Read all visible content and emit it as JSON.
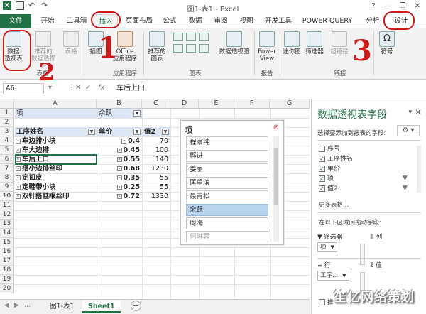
{
  "window": {
    "title": "图1-表1 - Excel",
    "app_logo": "X"
  },
  "tabs": [
    {
      "label": "文件"
    },
    {
      "label": "开始"
    },
    {
      "label": "工具箱"
    },
    {
      "label": "插入"
    },
    {
      "label": "页面布局"
    },
    {
      "label": "公式"
    },
    {
      "label": "数据"
    },
    {
      "label": "审阅"
    },
    {
      "label": "视图"
    },
    {
      "label": "开发工具"
    },
    {
      "label": "POWER QUERY"
    },
    {
      "label": "分析"
    },
    {
      "label": "设计"
    }
  ],
  "ribbon": {
    "pivot_btn": "数据\n透视表",
    "recommend_pivot_btn": "推荐的\n数据透视表",
    "table_btn": "表格",
    "illustrations_btn": "插图",
    "office_apps_btn": "Office\n应用程序",
    "recommended_charts_btn": "推荐的\n图表",
    "pivot_chart_btn": "数据透视图",
    "power_view_btn": "Power\nView",
    "sparkline_btn": "迷你图",
    "slicer_btn": "筛选器",
    "hyperlink_btn": "超链接",
    "symbol_btn": "符号",
    "groups": {
      "tables": "表格",
      "apps": "应用程序",
      "charts": "图表",
      "reports": "报告",
      "links": "链接"
    }
  },
  "annotations": {
    "n1": "1",
    "n2": "2",
    "n3": "3"
  },
  "formula_bar": {
    "name_box": "A6",
    "fx": "fx",
    "value": "车后上口"
  },
  "grid": {
    "columns": [
      "A",
      "B",
      "C",
      "D",
      "E",
      "F",
      "G"
    ],
    "rows": [
      "1",
      "2",
      "3",
      "4",
      "5",
      "6",
      "7",
      "8",
      "9",
      "10",
      "11",
      "12",
      "13",
      "14",
      "15",
      "16",
      "17",
      "18",
      "19",
      "20"
    ],
    "r1_a": "项",
    "r1_b": "余跃",
    "r3_a": "工序姓名",
    "r3_b": "单价",
    "r3_c": "值2",
    "data_rows": [
      {
        "name": "车边排小块",
        "price": "0.4",
        "value": "70"
      },
      {
        "name": "车大边排",
        "price": "0.45",
        "value": "100"
      },
      {
        "name": "车后上口",
        "price": "0.55",
        "value": "140"
      },
      {
        "name": "搭小边排丝印",
        "price": "0.68",
        "value": "1230"
      },
      {
        "name": "定扣皮",
        "price": "0.35",
        "value": "55"
      },
      {
        "name": "定鞋带小块",
        "price": "0.25",
        "value": "55"
      },
      {
        "name": "双针搭鞋眼丝印",
        "price": "0.72",
        "value": "1330"
      }
    ]
  },
  "slicer": {
    "header": "项",
    "items": [
      {
        "label": "程家纯",
        "state": "normal"
      },
      {
        "label": "郭进",
        "state": "normal"
      },
      {
        "label": "姜丽",
        "state": "normal"
      },
      {
        "label": "匡重滨",
        "state": "normal"
      },
      {
        "label": "聂青松",
        "state": "normal"
      },
      {
        "label": "余跃",
        "state": "selected"
      },
      {
        "label": "周海",
        "state": "normal"
      },
      {
        "label": "何琳蓉",
        "state": "dim"
      }
    ]
  },
  "sheets": [
    {
      "label": "图1-表1",
      "active": false
    },
    {
      "label": "Sheet1",
      "active": true
    }
  ],
  "pivot_panel": {
    "title": "数据透视表字段",
    "subtitle": "选择要添加到报表的字段:",
    "fields": [
      {
        "label": "序号",
        "checked": false,
        "filtered": false
      },
      {
        "label": "工序姓名",
        "checked": true,
        "filtered": false
      },
      {
        "label": "单价",
        "checked": true,
        "filtered": false
      },
      {
        "label": "项",
        "checked": true,
        "filtered": true
      },
      {
        "label": "值2",
        "checked": true,
        "filtered": true
      }
    ],
    "more_tables": "更多表格...",
    "area_hint": "在以下区域间拖动字段:",
    "filters_label": "筛选器",
    "columns_label": "列",
    "rows_label": "行",
    "values_label": "值",
    "filter_pill": "项",
    "row_pill": "工序...",
    "defer_label": "推"
  },
  "watermark": "笙亿网络策划",
  "colors": {
    "excel_green": "#217346",
    "annotation_red": "#d01818",
    "slicer_selected": "#b9d3ee"
  }
}
